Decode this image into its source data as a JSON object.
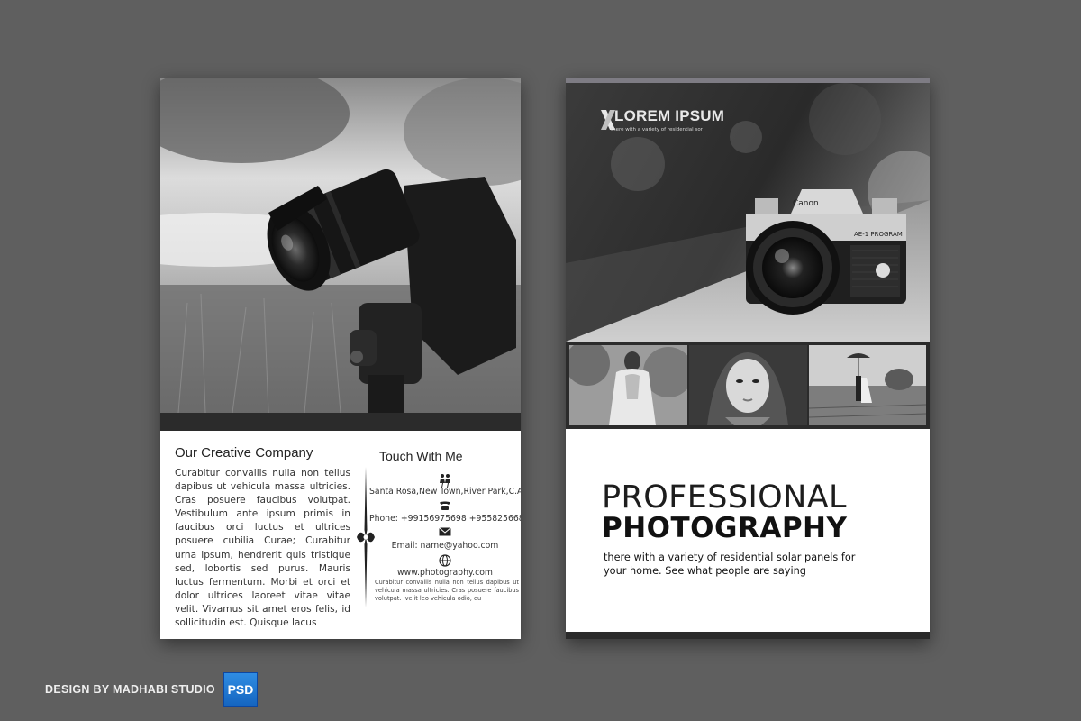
{
  "flyer_back": {
    "heading": "Our Creative Company",
    "body": "Curabitur convallis nulla non tellus dapibus ut vehicula massa ultricies. Cras posuere faucibus volutpat. Vestibulum ante ipsum primis in faucibus orci luctus et ultrices posuere cubilia Curae; Curabitur urna ipsum, hendrerit quis tristique sed, lobortis sed purus. Mauris luctus fermentum. Morbi et orci et dolor ultrices laoreet vitae vitae velit. Vivamus sit amet eros felis, id sollicitudin est. Quisque lacus",
    "contact_heading": "Touch With Me",
    "address": "Santa Rosa,New Town,River Park,C.A",
    "phone": "Phone: +99156975698  +955825668",
    "email": "Email: name@yahoo.com",
    "website": "www.photography.com",
    "small_text": "Curabitur convallis nulla non tellus dapibus ut vehicula massa ultricies. Cras posuere faucibus volutpat. ,velit leo vehicula odio, eu",
    "icons": [
      "people-icon",
      "phone-icon",
      "envelope-icon",
      "globe-icon"
    ]
  },
  "flyer_front": {
    "logo_text": "LOREM IPSUM",
    "logo_subtext": "there  with a variety of residential sor",
    "title_line1": "PROFESSIONAL",
    "title_line2": "PHOTOGRAPHY",
    "description": "there  with a variety of residential solar panels for your home. See what people are saying",
    "camera_brand": "Canon",
    "camera_model": "AE-1 PROGRAM"
  },
  "footer": {
    "credit": "DESIGN BY MADHABI STUDIO",
    "badge": "PSD"
  },
  "colors": {
    "background": "#5f5f5f",
    "dark_bar": "#2b2b2b",
    "badge_blue": "#1e7ad6"
  }
}
